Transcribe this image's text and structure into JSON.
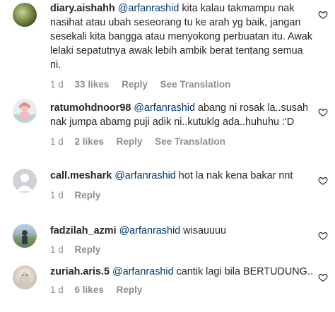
{
  "comments": [
    {
      "username": "diary.aishahh",
      "mention": "@arfanrashid",
      "text": " kita kalau takmampu nak nasihat atau ubah seseorang tu ke arah yg baik, jangan sesekali kita bangga atau menyokong perbuatan itu. Awak lelaki sepatutnya awak lebih ambik berat tentang semua ni.",
      "time": "1 d",
      "likes": "33 likes",
      "reply": "Reply",
      "translation": "See Translation"
    },
    {
      "username": "ratumohdnoor98",
      "mention": "@arfanrashid",
      "text": " abang ni rosak la..susah nak jumpa abamg puji adik ni..kutuklg ada..huhuhu :'D",
      "time": "1 d",
      "likes": "2 likes",
      "reply": "Reply",
      "translation": "See Translation"
    },
    {
      "username": "call.meshark",
      "mention": "@arfanrashid",
      "text": " hot la nak kena bakar nnt",
      "time": "1 d",
      "reply": "Reply"
    },
    {
      "username": "fadzilah_azmi",
      "mention": "@arfanrashid",
      "text": " wisauuuu",
      "time": "1 d",
      "reply": "Reply"
    },
    {
      "username": "zuriah.aris.5",
      "mention": "@arfanrashid",
      "text": " cantik lagi bila BERTUDUNG..",
      "time": "1 d",
      "likes": "6 likes",
      "reply": "Reply"
    }
  ],
  "icons": {
    "heart": "heart-outline-icon",
    "default_avatar": "default-avatar-icon"
  },
  "colors": {
    "text": "#262626",
    "mention": "#00376b",
    "meta": "#8e8e8e"
  }
}
